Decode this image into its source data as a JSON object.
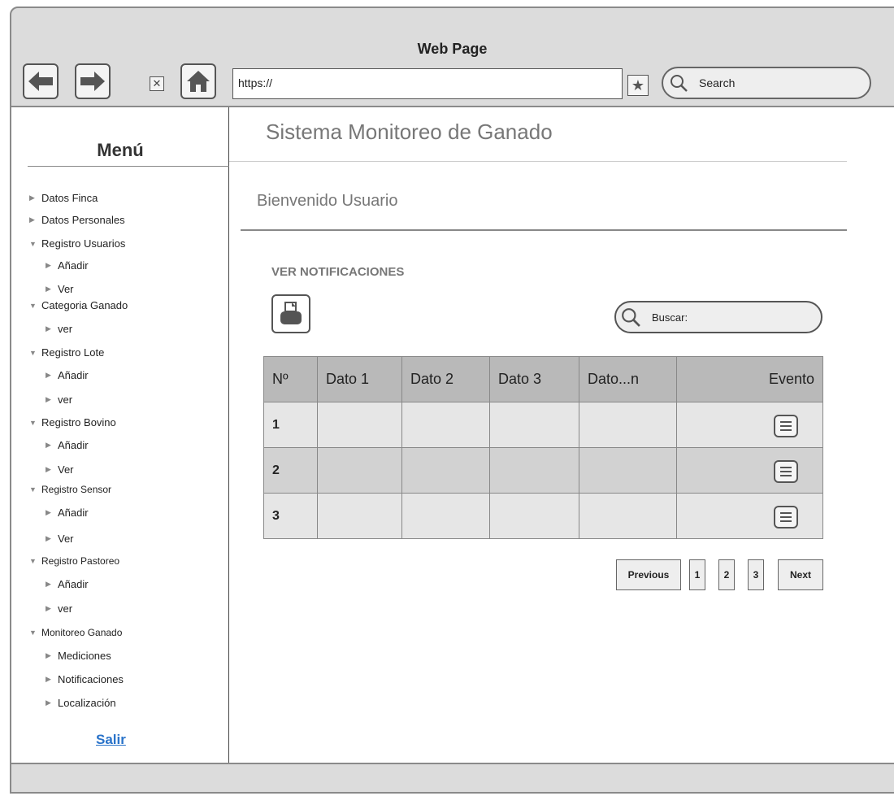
{
  "window": {
    "title": "Web Page"
  },
  "toolbar": {
    "url": "https://",
    "search_placeholder": "Search"
  },
  "sidebar": {
    "title": "Menú",
    "items": [
      {
        "label": "Datos Finca",
        "expanded": false,
        "level": 0
      },
      {
        "label": "Datos Personales",
        "expanded": false,
        "level": 0
      },
      {
        "label": "Registro Usuarios",
        "expanded": true,
        "level": 0
      },
      {
        "label": "Añadir",
        "expanded": false,
        "level": 1
      },
      {
        "label": "Ver",
        "expanded": false,
        "level": 1
      },
      {
        "label": "Categoria Ganado",
        "expanded": true,
        "level": 0
      },
      {
        "label": "ver",
        "expanded": false,
        "level": 1
      },
      {
        "label": "Registro Lote",
        "expanded": true,
        "level": 0
      },
      {
        "label": "Añadir",
        "expanded": false,
        "level": 1
      },
      {
        "label": "ver",
        "expanded": false,
        "level": 1
      },
      {
        "label": "Registro Bovino",
        "expanded": true,
        "level": 0
      },
      {
        "label": "Añadir",
        "expanded": false,
        "level": 1
      },
      {
        "label": "Ver",
        "expanded": false,
        "level": 1
      },
      {
        "label": "Registro Sensor",
        "expanded": true,
        "level": 0
      },
      {
        "label": "Añadir",
        "expanded": false,
        "level": 1
      },
      {
        "label": "Ver",
        "expanded": false,
        "level": 1
      },
      {
        "label": "Registro Pastoreo",
        "expanded": true,
        "level": 0
      },
      {
        "label": "Añadir",
        "expanded": false,
        "level": 1
      },
      {
        "label": "ver",
        "expanded": false,
        "level": 1
      },
      {
        "label": "Monitoreo Ganado",
        "expanded": true,
        "level": 0
      },
      {
        "label": "Mediciones",
        "expanded": false,
        "level": 1
      },
      {
        "label": "Notificaciones",
        "expanded": false,
        "level": 1
      },
      {
        "label": "Localización",
        "expanded": false,
        "level": 1
      }
    ],
    "logout": "Salir"
  },
  "main": {
    "title": "Sistema Monitoreo de Ganado",
    "welcome": "Bienvenido Usuario",
    "section": "VER NOTIFICACIONES",
    "search_label": "Buscar:",
    "table": {
      "headers": [
        "Nº",
        "Dato 1",
        "Dato 2",
        "Dato 3",
        "Dato...n",
        "Evento"
      ],
      "rows": [
        [
          "1",
          "",
          "",
          "",
          "",
          ""
        ],
        [
          "2",
          "",
          "",
          "",
          "",
          ""
        ],
        [
          "3",
          "",
          "",
          "",
          "",
          ""
        ]
      ]
    },
    "pagination": {
      "previous": "Previous",
      "pages": [
        "1",
        "2",
        "3"
      ],
      "next": "Next"
    }
  },
  "colors": {
    "chrome": "#dcdcdc",
    "table_header": "#b9b9b9",
    "row_light": "#e6e6e6",
    "row_dark": "#d2d2d2",
    "link": "#2a73c9"
  }
}
